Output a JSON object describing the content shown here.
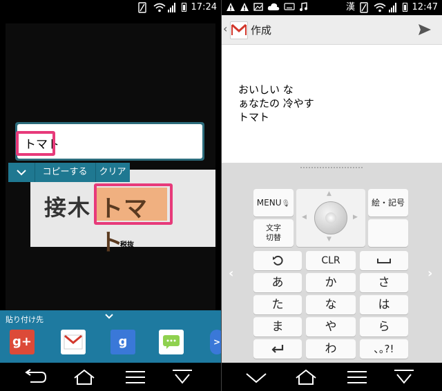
{
  "left": {
    "status": {
      "time": "17:24"
    },
    "sign": {
      "left_text": "接木",
      "highlight_text": "トマト",
      "small_text": "税抜"
    },
    "text_box": {
      "value": "トマト"
    },
    "controls": {
      "collapse_icon": "chevron-down-icon",
      "copy": "コピーする",
      "clear": "クリア"
    },
    "share": {
      "label": "貼り付け先",
      "apps": [
        {
          "name": "google-plus",
          "text": "g+",
          "color": "#dc4a38"
        },
        {
          "name": "gmail",
          "text": "M",
          "color": "#ffffff"
        },
        {
          "name": "google-search",
          "text": "g",
          "color": "#3a78d8"
        },
        {
          "name": "messages",
          "text": "···",
          "color": "#ffffff"
        }
      ]
    }
  },
  "right": {
    "status": {
      "time": "12:47",
      "ime": "漢"
    },
    "appbar": {
      "title": "作成"
    },
    "body_lines": [
      "おいしい な",
      "ぁなたの 冷やす",
      "トマト"
    ],
    "keyboard": {
      "menu": "MENU",
      "emoji": "絵・記号",
      "moji": [
        "文字",
        "切替"
      ],
      "clr": "CLR",
      "rows": [
        [
          "あ",
          "か",
          "さ"
        ],
        [
          "た",
          "な",
          "は"
        ],
        [
          "ま",
          "や",
          "ら"
        ],
        [
          "わ"
        ]
      ],
      "punct": "､｡?!"
    }
  },
  "colors": {
    "accent_teal": "#1e7aa0",
    "highlight_pink": "#e73a7a"
  }
}
